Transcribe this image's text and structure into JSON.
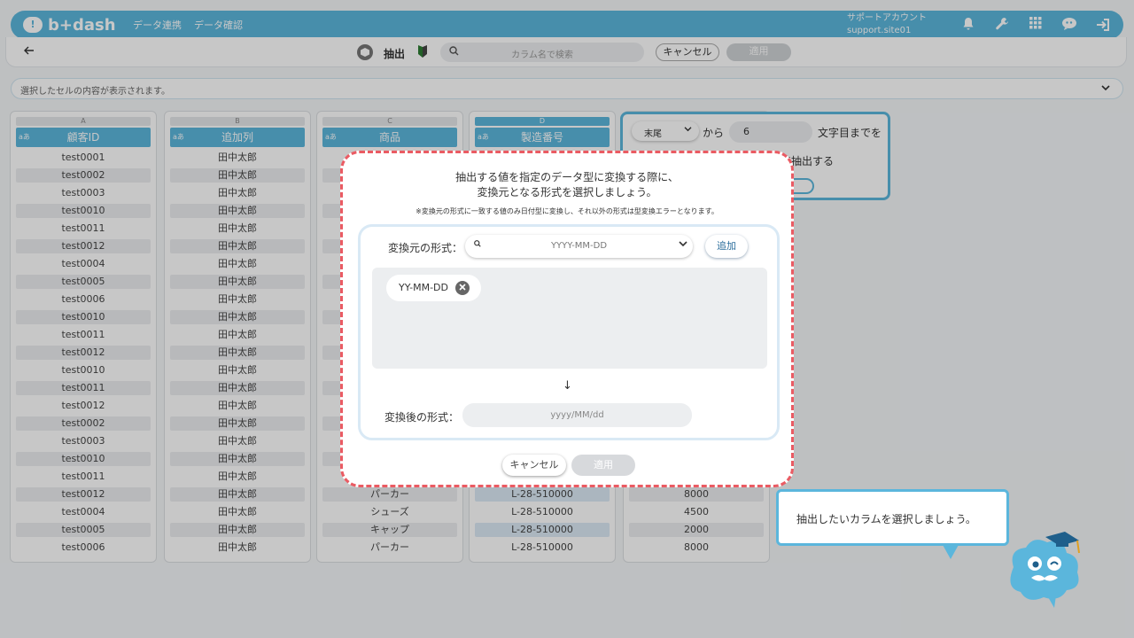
{
  "header": {
    "logo_text": "b+dash",
    "logo_mark": "!",
    "nav": [
      "データ連携",
      "データ確認"
    ],
    "account_name": "サポートアカウント",
    "account_id": "support.site01"
  },
  "toolbar": {
    "title": "抽出",
    "search_placeholder": "カラム名で検索",
    "cancel_label": "キャンセル",
    "apply_label": "適用"
  },
  "cell_bar": {
    "placeholder": "選択したセルの内容が表示されます。"
  },
  "table": {
    "type_badge": "aあ",
    "columns": [
      {
        "letter": "A",
        "name": "顧客ID",
        "cells": [
          "test0001",
          "test0002",
          "test0003",
          "test0010",
          "test0011",
          "test0012",
          "test0004",
          "test0005",
          "test0006",
          "test0010",
          "test0011",
          "test0012",
          "test0010",
          "test0011",
          "test0012",
          "test0002",
          "test0003",
          "test0010",
          "test0011",
          "test0012",
          "test0004",
          "test0005",
          "test0006"
        ]
      },
      {
        "letter": "B",
        "name": "追加列",
        "cells": [
          "田中太郎",
          "田中太郎",
          "田中太郎",
          "田中太郎",
          "田中太郎",
          "田中太郎",
          "田中太郎",
          "田中太郎",
          "田中太郎",
          "田中太郎",
          "田中太郎",
          "田中太郎",
          "田中太郎",
          "田中太郎",
          "田中太郎",
          "田中太郎",
          "田中太郎",
          "田中太郎",
          "田中太郎",
          "田中太郎",
          "田中太郎",
          "田中太郎",
          "田中太郎"
        ]
      },
      {
        "letter": "C",
        "name": "商品",
        "cells": [
          "",
          "",
          "",
          "",
          "",
          "",
          "",
          "",
          "",
          "",
          "",
          "",
          "",
          "",
          "",
          "",
          "",
          "",
          "",
          "パーカー",
          "シューズ",
          "キャップ",
          "パーカー"
        ]
      },
      {
        "letter": "D",
        "name": "製造番号",
        "cells": [
          "",
          "",
          "",
          "",
          "",
          "",
          "",
          "",
          "",
          "",
          "",
          "",
          "",
          "",
          "",
          "",
          "",
          "",
          "",
          "L-28-510000",
          "L-28-510000",
          "L-28-510000",
          "L-28-510000"
        ]
      },
      {
        "letter": "",
        "name": "",
        "cells": [
          "",
          "",
          "",
          "",
          "",
          "",
          "",
          "",
          "",
          "",
          "",
          "",
          "",
          "",
          "",
          "",
          "",
          "",
          "",
          "8000",
          "4500",
          "2000",
          "8000"
        ]
      }
    ]
  },
  "extract_panel": {
    "position_select": "末尾",
    "from_label": "から",
    "count_value": "6",
    "char_label": "文字目までを",
    "action_label": "て抽出する"
  },
  "hint": {
    "text": "抽出したいカラムを選択しましょう。"
  },
  "modal": {
    "title_line1": "抽出する値を指定のデータ型に変換する際に、",
    "title_line2": "変換元となる形式を選択しましょう。",
    "note": "※変換元の形式に一致する値のみ日付型に変換し、それ以外の形式は型変換エラーとなります。",
    "from_label": "変換元の形式：",
    "from_select_value": "YYYY-MM-DD",
    "add_label": "追加",
    "selected_formats": [
      "YY-MM-DD"
    ],
    "arrow": "↓",
    "to_label": "変換後の形式：",
    "to_placeholder": "yyyy/MM/dd",
    "cancel_label": "キャンセル",
    "apply_label": "適用"
  },
  "colors": {
    "brand": "#5bb6dc",
    "highlight_border": "#ea5b63"
  }
}
